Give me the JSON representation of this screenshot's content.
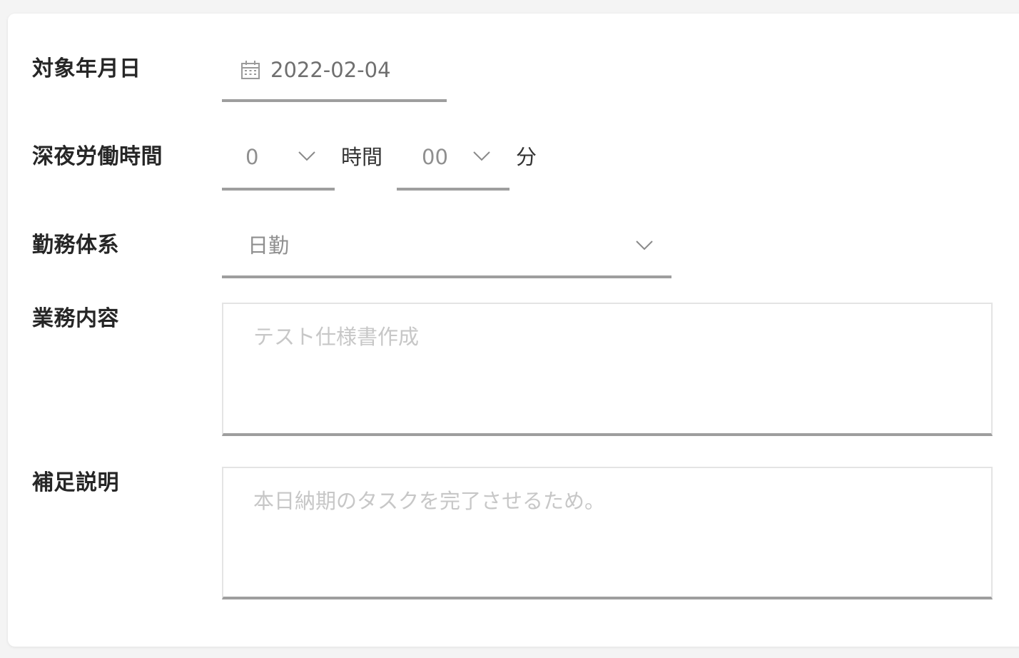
{
  "form": {
    "date": {
      "label": "対象年月日",
      "value": "2022-02-04",
      "icon": "calendar-icon"
    },
    "night_hours": {
      "label": "深夜労働時間",
      "hours_value": "0",
      "hours_unit": "時間",
      "minutes_value": "00",
      "minutes_unit": "分"
    },
    "work_system": {
      "label": "勤務体系",
      "value": "日勤"
    },
    "work_content": {
      "label": "業務内容",
      "placeholder": "テスト仕様書作成"
    },
    "notes": {
      "label": "補足説明",
      "placeholder": "本日納期のタスクを完了させるため。"
    }
  },
  "colors": {
    "underline": "#9e9e9e",
    "placeholder": "#c7c7c7",
    "value_text": "#8f8f8f"
  }
}
